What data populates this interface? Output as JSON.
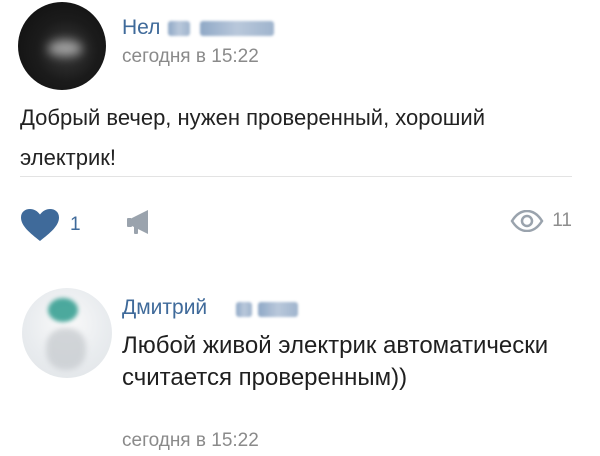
{
  "post": {
    "author_name": "Нел",
    "time": "сегодня в 15:22",
    "text": "Добрый вечер, нужен проверенный, хороший электрик!",
    "likes_count": "1",
    "views_count": "11",
    "icons": {
      "like": "heart-icon",
      "share": "megaphone-icon",
      "views": "eye-icon"
    }
  },
  "comment": {
    "author_name": "Дмитрий",
    "text": "Любой живой электрик автоматически считается проверенным))",
    "time": "сегодня в 15:22"
  },
  "colors": {
    "link": "#3f6a9a",
    "meta": "#8a8a8a",
    "background": "#ffffff"
  }
}
